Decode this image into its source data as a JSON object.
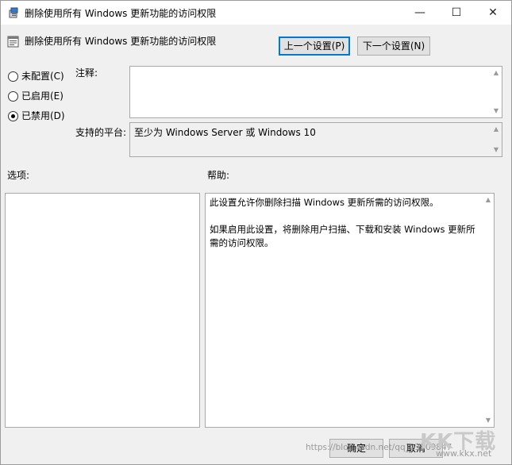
{
  "window": {
    "title": "删除使用所有 Windows 更新功能的访问权限",
    "icon": "gpedit-icon",
    "controls": {
      "minimize": "—",
      "maximize": "☐",
      "close": "✕"
    }
  },
  "header": {
    "policy_name": "删除使用所有 Windows 更新功能的访问权限",
    "prev_button": "上一个设置(P)",
    "next_button": "下一个设置(N)"
  },
  "state_options": [
    {
      "label": "未配置(C)",
      "checked": false
    },
    {
      "label": "已启用(E)",
      "checked": false
    },
    {
      "label": "已禁用(D)",
      "checked": true
    }
  ],
  "comment": {
    "label": "注释:",
    "value": ""
  },
  "platform": {
    "label": "支持的平台:",
    "value": "至少为 Windows Server 或 Windows 10"
  },
  "options": {
    "label": "选项:"
  },
  "help": {
    "label": "帮助:",
    "paragraphs": [
      "此设置允许你删除扫描 Windows 更新所需的访问权限。",
      "如果启用此设置，将删除用户扫描、下载和安装 Windows 更新所需的访问权限。"
    ]
  },
  "footer": {
    "ok_button": "确定",
    "cancel_button": "取消"
  },
  "watermark": {
    "url_text": "https://blog.csdn.net/qq_23809847",
    "logo_text": "KK下载",
    "logo_site": "www.kkx.net"
  }
}
